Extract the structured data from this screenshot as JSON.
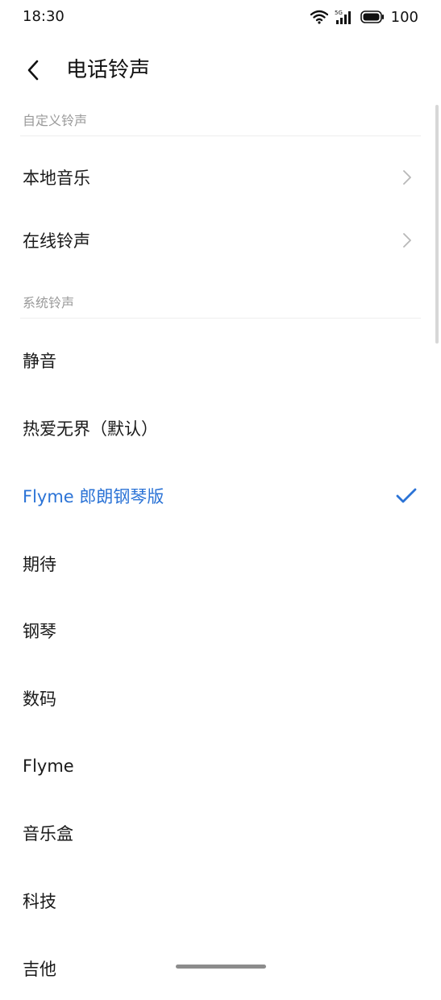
{
  "status_bar": {
    "time": "18:30",
    "battery_text": "100",
    "icons": [
      "wifi-icon",
      "signal-5g-icon",
      "battery-icon"
    ]
  },
  "header": {
    "title": "电话铃声",
    "back_icon": "chevron-left-icon"
  },
  "sections": {
    "custom": {
      "header": "自定义铃声",
      "items": [
        {
          "label": "本地音乐",
          "icon": "chevron-right-icon"
        },
        {
          "label": "在线铃声",
          "icon": "chevron-right-icon"
        }
      ]
    },
    "system": {
      "header": "系统铃声",
      "items": [
        {
          "label": "静音"
        },
        {
          "label": "热爱无界（默认）"
        },
        {
          "label": "Flyme 郎朗钢琴版",
          "selected": true,
          "icon": "checkmark-icon"
        },
        {
          "label": "期待"
        },
        {
          "label": "钢琴"
        },
        {
          "label": "数码"
        },
        {
          "label": "Flyme"
        },
        {
          "label": "音乐盒"
        },
        {
          "label": "科技"
        },
        {
          "label": "吉他"
        }
      ]
    }
  },
  "colors": {
    "accent": "#2b73d6",
    "text": "#1a1a1a",
    "section_header": "#9a9a9a",
    "divider": "#eeeeee"
  }
}
